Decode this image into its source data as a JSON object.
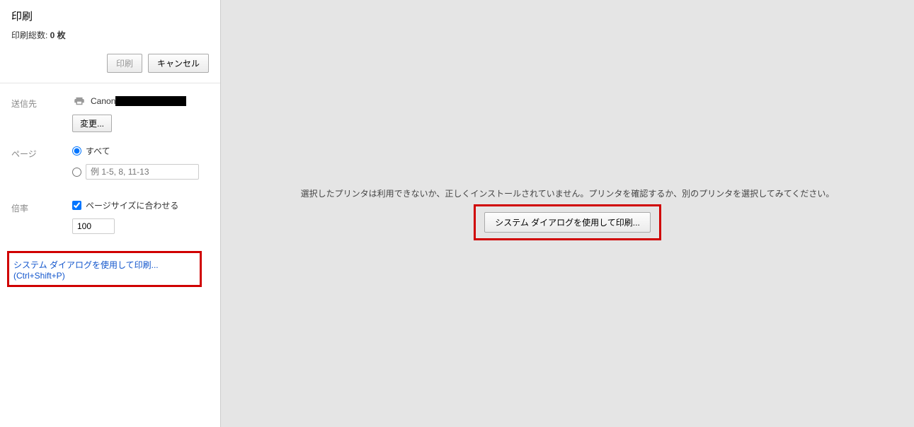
{
  "header": {
    "title": "印刷",
    "total_prefix": "印刷総数: ",
    "total_value": "0 枚",
    "print_label": "印刷",
    "cancel_label": "キャンセル"
  },
  "destination": {
    "label": "送信先",
    "printer_name": "Canon",
    "change_label": "変更..."
  },
  "pages": {
    "label": "ページ",
    "all_label": "すべて",
    "range_placeholder": "例 1-5, 8, 11-13"
  },
  "scale": {
    "label": "倍率",
    "fit_label": "ページサイズに合わせる",
    "value": "100"
  },
  "footer": {
    "system_dialog_label": "システム ダイアログを使用して印刷...",
    "shortcut": "(Ctrl+Shift+P)"
  },
  "preview": {
    "error_message": "選択したプリンタは利用できないか、正しくインストールされていません。プリンタを確認するか、別のプリンタを選択してみてください。",
    "system_dialog_button": "システム ダイアログを使用して印刷..."
  }
}
